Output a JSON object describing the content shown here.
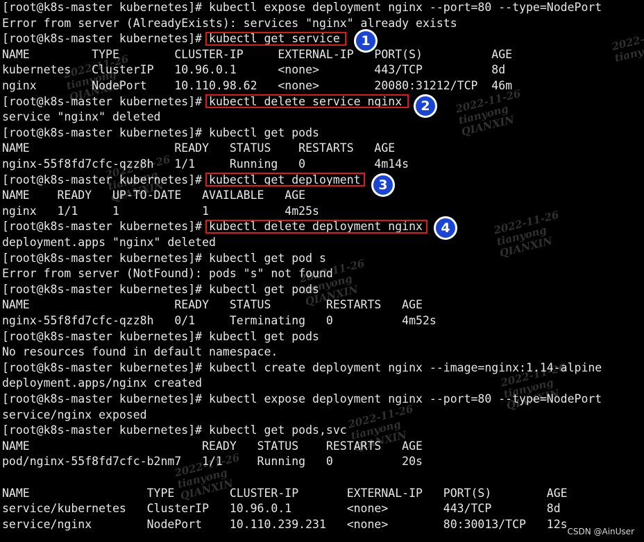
{
  "terminal": {
    "lines": [
      "[root@k8s-master kubernetes]# kubectl expose deployment nginx --port=80 --type=NodePort",
      "Error from server (AlreadyExists): services \"nginx\" already exists",
      "[root@k8s-master kubernetes]# kubectl get service",
      "NAME         TYPE        CLUSTER-IP     EXTERNAL-IP   PORT(S)          AGE",
      "kubernetes   ClusterIP   10.96.0.1      <none>        443/TCP          8d",
      "nginx        NodePort    10.110.98.62   <none>        20080:31212/TCP  46m",
      "[root@k8s-master kubernetes]# kubectl delete service nginx",
      "service \"nginx\" deleted",
      "[root@k8s-master kubernetes]# kubectl get pods",
      "NAME                     READY   STATUS    RESTARTS   AGE",
      "nginx-55f8fd7cfc-qzz8h   1/1     Running   0          4m14s",
      "[root@k8s-master kubernetes]# kubectl get deployment",
      "NAME    READY   UP-TO-DATE   AVAILABLE   AGE",
      "nginx   1/1     1            1           4m25s",
      "[root@k8s-master kubernetes]# kubectl delete deployment nginx",
      "deployment.apps \"nginx\" deleted",
      "[root@k8s-master kubernetes]# kubectl get pod s",
      "Error from server (NotFound): pods \"s\" not found",
      "[root@k8s-master kubernetes]# kubectl get pods",
      "NAME                     READY   STATUS        RESTARTS   AGE",
      "nginx-55f8fd7cfc-qzz8h   0/1     Terminating   0          4m52s",
      "[root@k8s-master kubernetes]# kubectl get pods",
      "No resources found in default namespace.",
      "[root@k8s-master kubernetes]# kubectl create deployment nginx --image=nginx:1.14-alpine",
      "deployment.apps/nginx created",
      "[root@k8s-master kubernetes]# kubectl expose deployment nginx --port=80 --type=NodePort",
      "service/nginx exposed",
      "[root@k8s-master kubernetes]# kubectl get pods,svc",
      "NAME                         READY   STATUS    RESTARTS   AGE",
      "pod/nginx-55f8fd7cfc-b2nm7   1/1     Running   0          20s",
      "",
      "NAME                 TYPE        CLUSTER-IP       EXTERNAL-IP   PORT(S)        AGE",
      "service/kubernetes   ClusterIP   10.96.0.1        <none>        443/TCP        8d",
      "service/nginx        NodePort    10.110.239.231   <none>        80:30013/TCP   12s"
    ]
  },
  "annotations": [
    {
      "number": "1",
      "command": "kubectl get service"
    },
    {
      "number": "2",
      "command": "kubectl delete service nginx"
    },
    {
      "number": "3",
      "command": "kubectl get deployment"
    },
    {
      "number": "4",
      "command": "kubectl delete deployment nginx"
    }
  ],
  "watermark": {
    "date": "2022-11-26",
    "user": "tianyong",
    "org": "QIANXIN"
  },
  "credit": "CSDN @AinUser",
  "colors": {
    "background": "#000000",
    "text": "#e8e8e8",
    "highlight_box": "#e01818",
    "badge_fill": "#1a44d8"
  }
}
